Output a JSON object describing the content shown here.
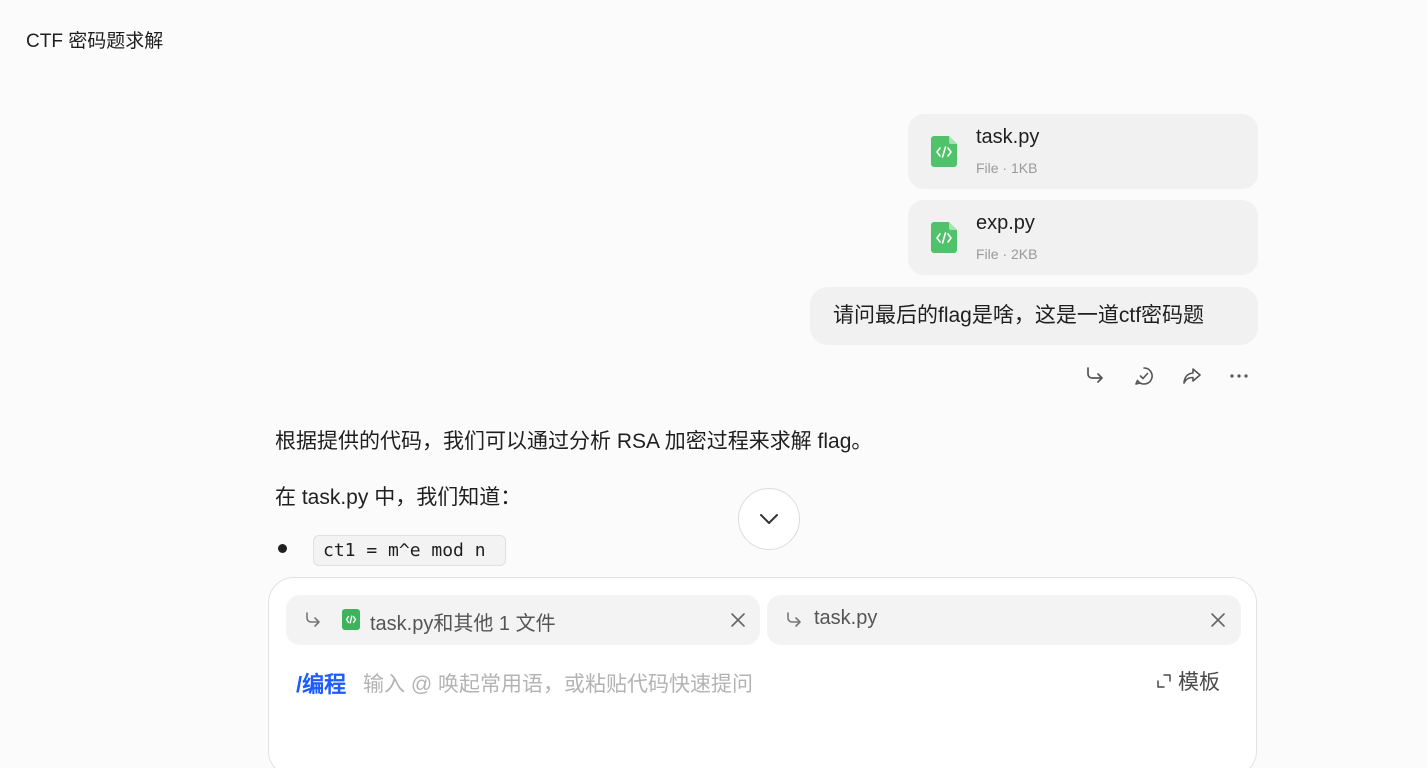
{
  "conversation": {
    "title": "CTF 密码题求解"
  },
  "attachments": [
    {
      "name": "task.py",
      "meta": "File · 1KB",
      "icon": "code-file-icon"
    },
    {
      "name": "exp.py",
      "meta": "File · 2KB",
      "icon": "code-file-icon"
    }
  ],
  "user_message": {
    "text": "请问最后的flag是啥，这是一道ctf密码题"
  },
  "message_actions": [
    "quote-reply-icon",
    "check-circle-icon",
    "share-icon",
    "more-icon"
  ],
  "assistant_reply": {
    "line1": "根据提供的代码，我们可以通过分析 RSA 加密过程来求解 flag。",
    "line2": "在 task.py 中，我们知道：",
    "bullet_code": "ct1 = m^e mod n"
  },
  "composer": {
    "references": [
      {
        "label": "task.py和其他 1 文件"
      },
      {
        "label": "task.py"
      }
    ],
    "mode": "/编程",
    "placeholder": "输入 @ 唤起常用语，或粘贴代码快速提问",
    "template_label": "模板"
  },
  "colors": {
    "accent": "#1e5bff",
    "file_icon_green": "#4fc26a",
    "bubble_bg": "#f1f1f1"
  }
}
